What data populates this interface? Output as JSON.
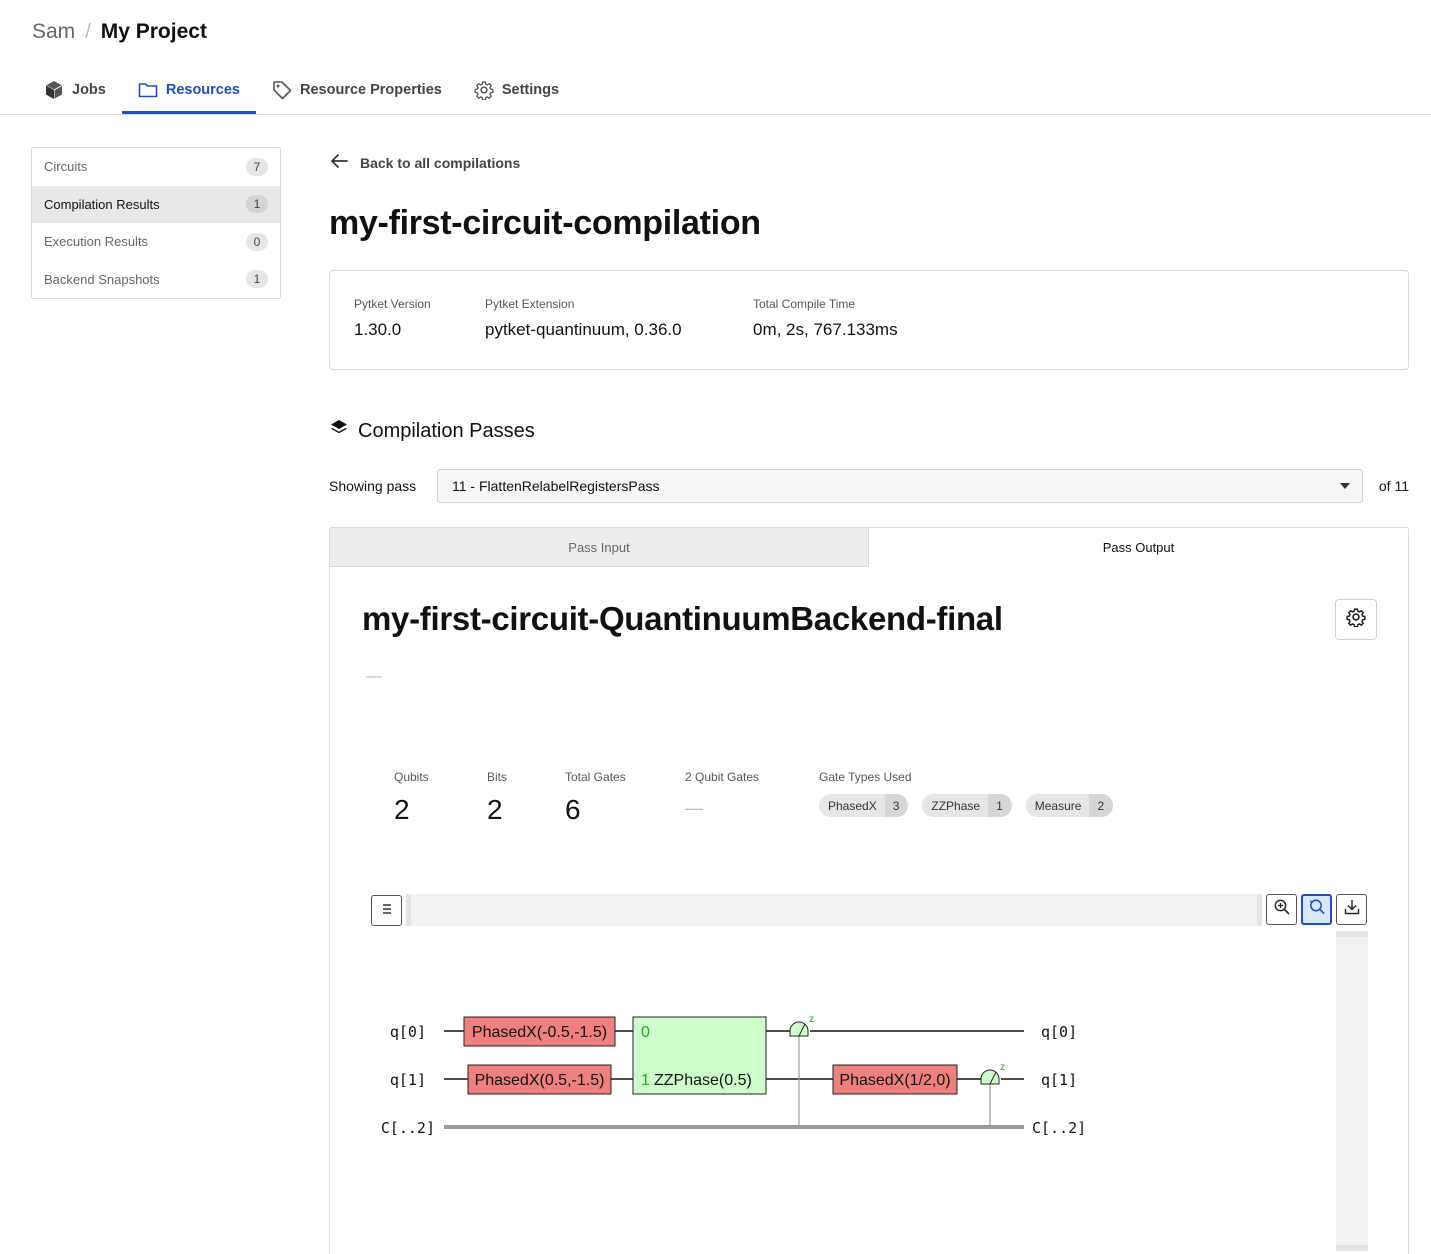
{
  "breadcrumb": {
    "user": "Sam",
    "separator": "/",
    "project": "My Project"
  },
  "nav_tabs": [
    {
      "label": "Jobs",
      "icon": "cube-icon"
    },
    {
      "label": "Resources",
      "icon": "folder-icon",
      "active": true
    },
    {
      "label": "Resource Properties",
      "icon": "tag-icon"
    },
    {
      "label": "Settings",
      "icon": "gear-icon"
    }
  ],
  "sidebar": {
    "items": [
      {
        "label": "Circuits",
        "count": "7"
      },
      {
        "label": "Compilation Results",
        "count": "1",
        "active": true
      },
      {
        "label": "Execution Results",
        "count": "0"
      },
      {
        "label": "Backend Snapshots",
        "count": "1"
      }
    ]
  },
  "main": {
    "back_label": "Back to all compilations",
    "title": "my-first-circuit-compilation",
    "meta": [
      {
        "label": "Pytket Version",
        "value": "1.30.0"
      },
      {
        "label": "Pytket Extension",
        "value": "pytket-quantinuum, 0.36.0"
      },
      {
        "label": "Total Compile Time",
        "value": "0m, 2s, 767.133ms"
      }
    ],
    "section_title": "Compilation Passes",
    "pass_selector": {
      "label": "Showing pass",
      "selected": "11 - FlattenRelabelRegistersPass",
      "total": "of 11"
    },
    "io_tabs": {
      "input": "Pass Input",
      "output": "Pass Output",
      "active": "output"
    }
  },
  "circuit": {
    "name": "my-first-circuit-QuantinuumBackend-final",
    "description": "—",
    "stats": {
      "qubits_label": "Qubits",
      "qubits": "2",
      "bits_label": "Bits",
      "bits": "2",
      "total_gates_label": "Total Gates",
      "total_gates": "6",
      "two_qubit_gates_label": "2 Qubit Gates",
      "two_qubit_gates": "—",
      "gate_types_label": "Gate Types Used"
    },
    "gate_types": [
      {
        "name": "PhasedX",
        "count": "3"
      },
      {
        "name": "ZZPhase",
        "count": "1"
      },
      {
        "name": "Measure",
        "count": "2"
      }
    ],
    "diagram": {
      "wires": {
        "q0": "q[0]",
        "q1": "q[1]",
        "c": "C[..2]"
      },
      "gates": {
        "g1": "PhasedX(-0.5,-1.5)",
        "g2": "PhasedX(0.5,-1.5)",
        "zz": "ZZPhase(0.5)",
        "zz_port0": "0",
        "zz_port1": "1",
        "g3": "PhasedX(1/2,0)",
        "measure_basis": "z"
      },
      "colors": {
        "phasedx": "#f08080",
        "zzphase": "#ccffcc",
        "measure": "#ccffcc",
        "port": "#22aa22"
      }
    }
  },
  "colors": {
    "accent": "#1f4fbf"
  }
}
